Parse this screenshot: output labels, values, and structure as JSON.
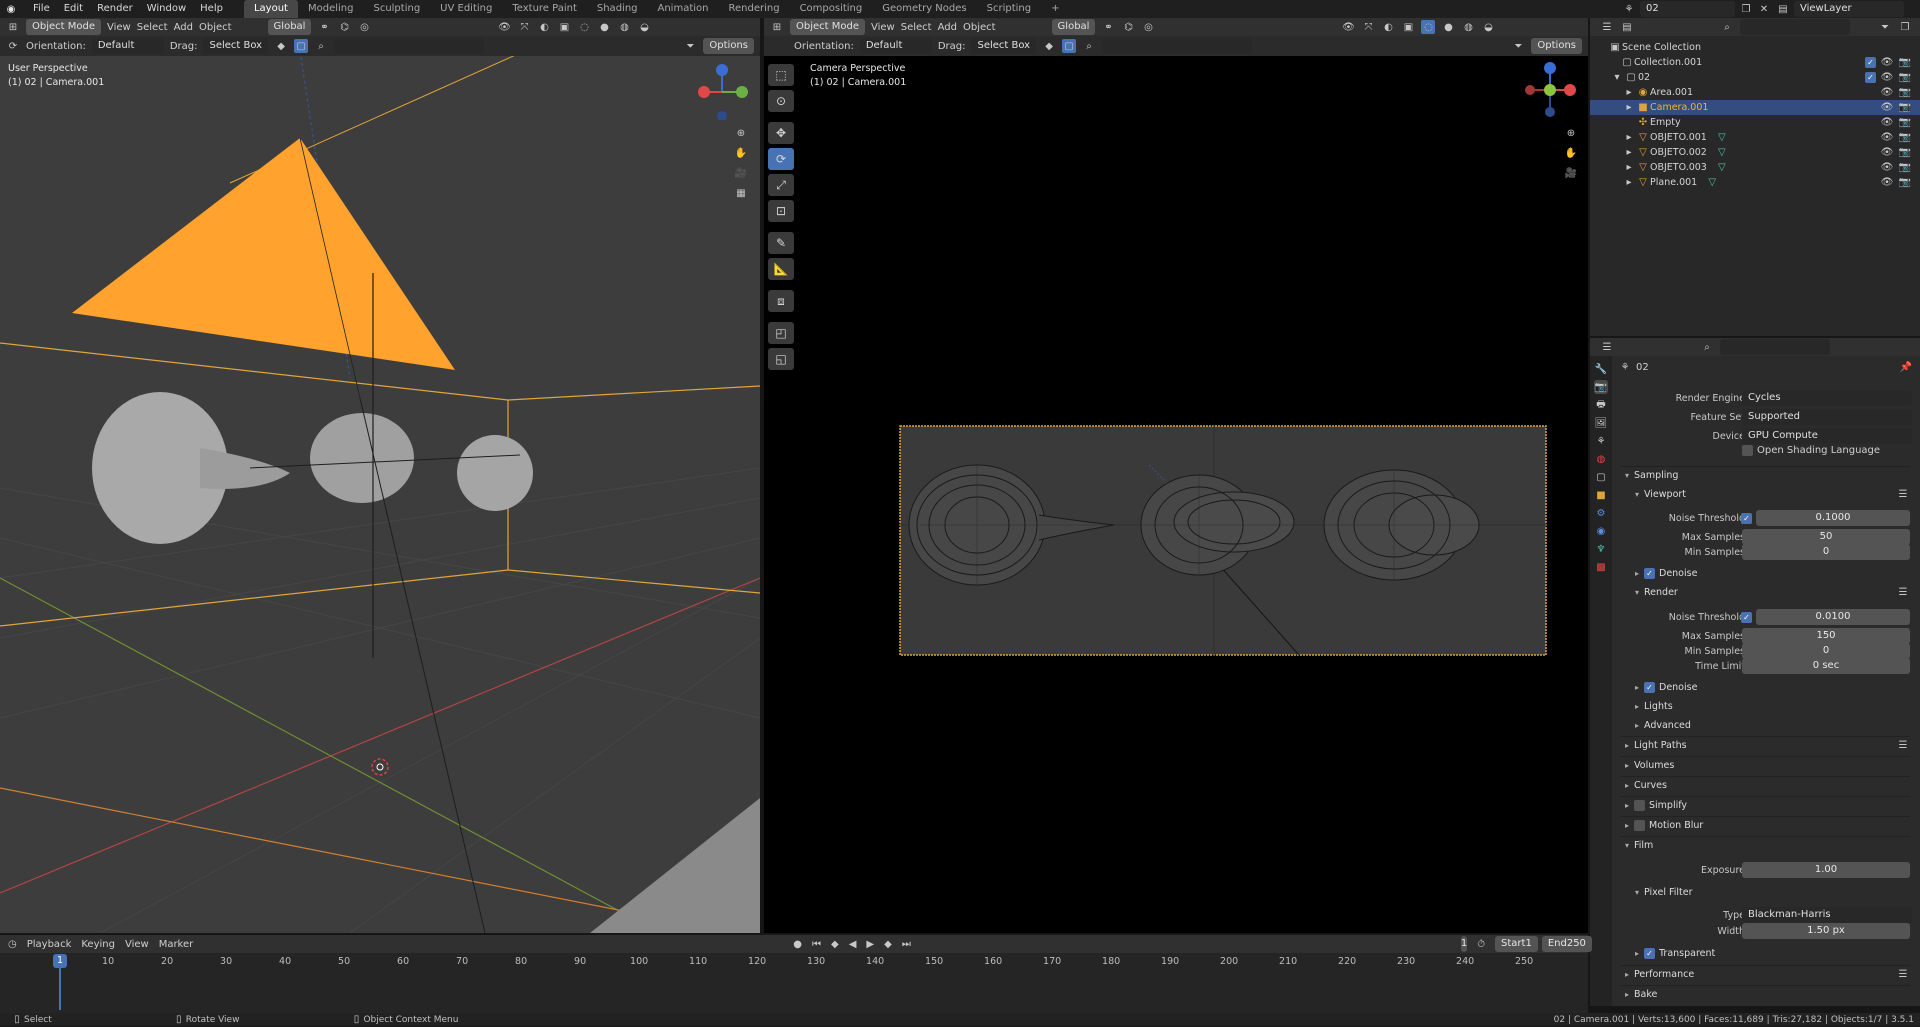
{
  "topbar": {
    "menus": [
      "File",
      "Edit",
      "Render",
      "Window",
      "Help"
    ],
    "workspaces": [
      "Layout",
      "Modeling",
      "Sculpting",
      "UV Editing",
      "Texture Paint",
      "Shading",
      "Animation",
      "Rendering",
      "Compositing",
      "Geometry Nodes",
      "Scripting"
    ],
    "active_workspace": "Layout",
    "add_tab": "+",
    "scene_name": "02",
    "view_layer": "ViewLayer"
  },
  "viewport_left": {
    "mode": "Object Mode",
    "menus": [
      "View",
      "Select",
      "Add",
      "Object"
    ],
    "transform": "Global",
    "orientation_label": "Orientation:",
    "orientation_value": "Default",
    "drag_label": "Drag:",
    "drag_value": "Select Box",
    "options": "Options",
    "overlay_title": "User Perspective",
    "overlay_sub": "(1) 02 | Camera.001"
  },
  "viewport_right": {
    "mode": "Object Mode",
    "menus": [
      "View",
      "Select",
      "Add",
      "Object"
    ],
    "transform": "Global",
    "orientation_label": "Orientation:",
    "orientation_value": "Default",
    "drag_label": "Drag:",
    "drag_value": "Select Box",
    "options": "Options",
    "overlay_title": "Camera Perspective",
    "overlay_sub": "(1) 02 | Camera.001"
  },
  "outliner": {
    "root": "Scene Collection",
    "items": [
      {
        "name": "Collection.001",
        "depth": 1
      },
      {
        "name": "02",
        "depth": 1
      },
      {
        "name": "Area.001",
        "depth": 2
      },
      {
        "name": "Camera.001",
        "depth": 2,
        "selected": true
      },
      {
        "name": "Empty",
        "depth": 2
      },
      {
        "name": "OBJETO.001",
        "depth": 2
      },
      {
        "name": "OBJETO.002",
        "depth": 2
      },
      {
        "name": "OBJETO.003",
        "depth": 2
      },
      {
        "name": "Plane.001",
        "depth": 2
      }
    ]
  },
  "properties": {
    "scene_name": "02",
    "render_engine_label": "Render Engine",
    "render_engine": "Cycles",
    "feature_set_label": "Feature Set",
    "feature_set": "Supported",
    "device_label": "Device",
    "device": "GPU Compute",
    "osl": "Open Shading Language",
    "sampling": "Sampling",
    "viewport": "Viewport",
    "noise_threshold_label": "Noise Threshold",
    "vp_noise": "0.1000",
    "max_samples_label": "Max Samples",
    "vp_max": "50",
    "min_samples_label": "Min Samples",
    "vp_min": "0",
    "denoise": "Denoise",
    "render": "Render",
    "r_noise": "0.0100",
    "r_max": "150",
    "r_min": "0",
    "time_limit_label": "Time Limit",
    "r_time": "0 sec",
    "lights": "Lights",
    "advanced": "Advanced",
    "light_paths": "Light Paths",
    "volumes": "Volumes",
    "curves": "Curves",
    "simplify": "Simplify",
    "motion_blur": "Motion Blur",
    "film": "Film",
    "exposure_label": "Exposure",
    "exposure": "1.00",
    "pixel_filter": "Pixel Filter",
    "type_label": "Type",
    "type": "Blackman-Harris",
    "width_label": "Width",
    "width": "1.50 px",
    "transparent": "Transparent",
    "performance": "Performance",
    "bake": "Bake"
  },
  "timeline": {
    "menus": [
      "Playback",
      "Keying",
      "View",
      "Marker"
    ],
    "current_frame": "1",
    "start_label": "Start",
    "start": "1",
    "end_label": "End",
    "end": "250",
    "ticks": [
      "1",
      "10",
      "20",
      "30",
      "40",
      "50",
      "60",
      "70",
      "80",
      "90",
      "100",
      "110",
      "120",
      "130",
      "140",
      "150",
      "160",
      "170",
      "180",
      "190",
      "200",
      "210",
      "220",
      "230",
      "240",
      "250"
    ]
  },
  "statusbar": {
    "select": "Select",
    "rotate": "Rotate View",
    "context": "Object Context Menu",
    "stats": "02 | Camera.001 | Verts:13,600 | Faces:11,689 | Tris:27,182 | Objects:1/7 | 3.5.1"
  },
  "colors": {
    "accent": "#4772b3",
    "camera": "#ffa22e",
    "panel": "#303030"
  }
}
